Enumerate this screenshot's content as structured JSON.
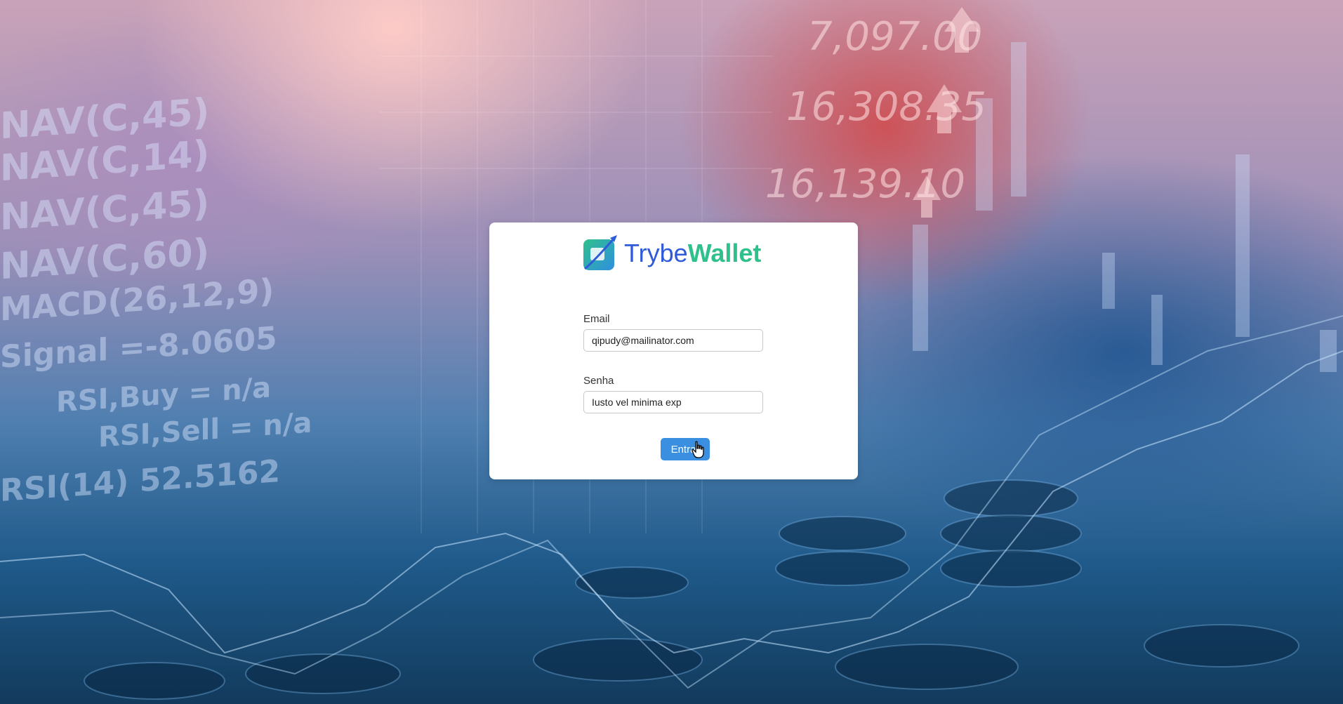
{
  "app": {
    "logo_text_part1": "Trybe",
    "logo_text_part2": "Wallet",
    "colors": {
      "trybe": "#2f5ad8",
      "wallet": "#2fc18c",
      "button": "#3b8fe0"
    }
  },
  "background": {
    "tickers": [
      "NAV(C,45)",
      "NAV(C,14)",
      "NAV(C,45)",
      "NAV(C,60)",
      "MACD(26,12,9)",
      "Signal =-8.0605",
      "RSI,Buy = n/a",
      "RSI,Sell = n/a",
      "RSI(14) 52.5162"
    ],
    "prices": [
      "7,097.00",
      "16,308.35",
      "16,139.10"
    ]
  },
  "login": {
    "email_label": "Email",
    "email_value": "qipudy@mailinator.com",
    "password_label": "Senha",
    "password_value": "Iusto vel minima exp",
    "submit_label": "Entrar"
  }
}
